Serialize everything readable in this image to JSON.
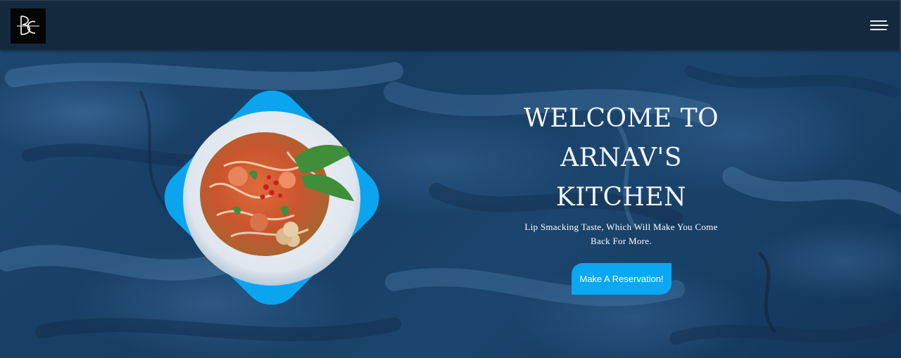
{
  "header": {
    "logo_text": "BC",
    "menu_icon": "hamburger-menu-icon"
  },
  "hero": {
    "title": "WELCOME TO ARNAV'S KITCHEN",
    "subtitle": "Lip Smacking Taste, Which Will Make You Come Back For More.",
    "cta_label": "Make A Reservation!",
    "food_image": "bowl-of-noodle-soup-image"
  },
  "colors": {
    "header_bg": "#14293e",
    "hero_bg": "#1a4268",
    "accent": "#0aa7f2",
    "text": "#ffffff"
  }
}
